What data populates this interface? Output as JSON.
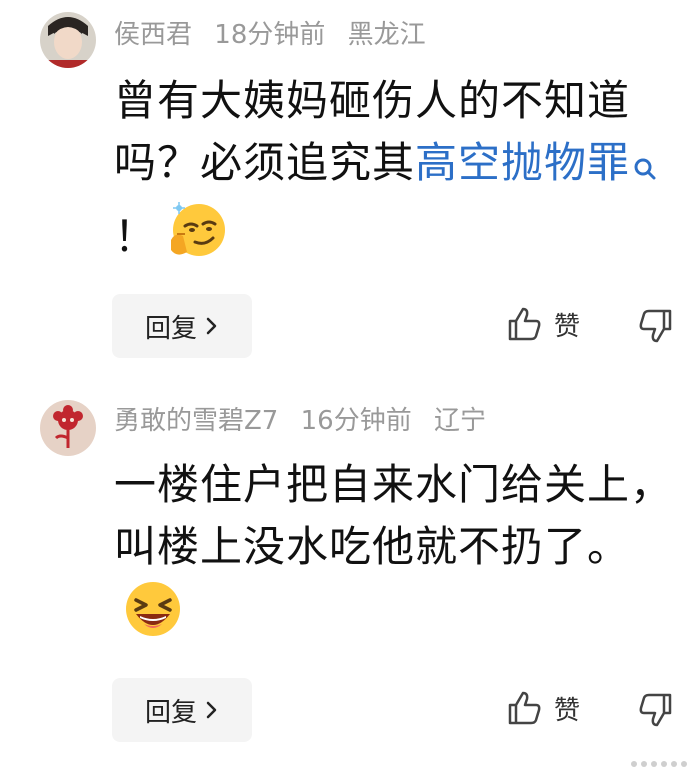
{
  "comments": [
    {
      "username": "侯西君",
      "time": "18分钟前",
      "location": "黑龙江",
      "text_before": "曾有大姨妈砸伤人的不知道吗？必须追究其",
      "link_term": "高空抛物罪",
      "text_after": "！",
      "emoji": "smirk-emoji",
      "reply_label": "回复",
      "like_label": "赞"
    },
    {
      "username": "勇敢的雪碧Z7",
      "time": "16分钟前",
      "location": "辽宁",
      "text_before": "一楼住户把自来水门给关上，叫楼上没水吃他就不扔了。",
      "link_term": "",
      "text_after": "",
      "emoji": "laughing-emoji",
      "reply_label": "回复",
      "like_label": "赞"
    }
  ],
  "colors": {
    "link": "#2c6fc7",
    "meta": "#999999",
    "reply_bg": "#f4f4f4"
  }
}
